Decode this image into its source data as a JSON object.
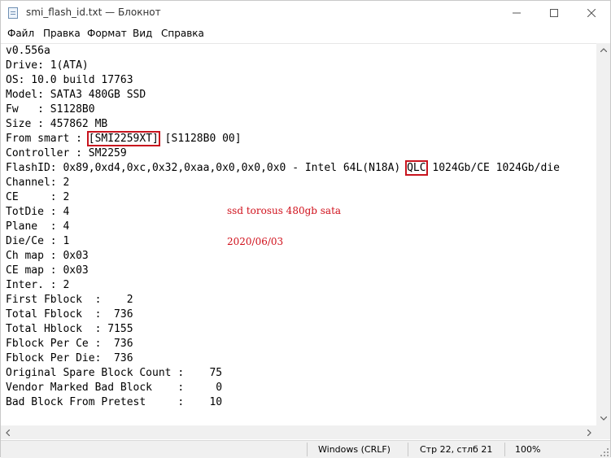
{
  "window": {
    "title": "smi_flash_id.txt — Блокнот",
    "icon": "notepad-icon",
    "controls": [
      "minimize-icon",
      "maximize-icon",
      "close-icon"
    ]
  },
  "menu": {
    "items": [
      "Файл",
      "Правка",
      "Формат",
      "Вид",
      "Справка"
    ]
  },
  "document": {
    "lines": [
      "v0.556a",
      "Drive: 1(ATA)",
      "OS: 10.0 build 17763",
      "Model: SATA3 480GB SSD",
      "Fw   : S1128B0",
      "Size : 457862 MB",
      "From smart : ",
      "Controller : SM2259",
      "FlashID: 0x89,0xd4,0xc,0x32,0xaa,0x0,0x0,0x0 - Intel 64L(N18A) ",
      "Channel: 2",
      "CE     : 2",
      "TotDie : 4",
      "Plane  : 4",
      "Die/Ce : 1",
      "Ch map : 0x03",
      "CE map : 0x03",
      "Inter. : 2",
      "First Fblock  :    2",
      "Total Fblock  :  736",
      "Total Hblock  : 7155",
      "Fblock Per Ce :  736",
      "Fblock Per Die:  736",
      "Original Spare Block Count :    75",
      "Vendor Marked Bad Block    :     0",
      "Bad Block From Pretest     :    10"
    ],
    "smart_highlight": "[SMI2259XT]",
    "smart_rest": " [S1128B0 00]",
    "flash_highlight": "QLC",
    "flash_rest": " 1024Gb/CE 1024Gb/die"
  },
  "annotations": {
    "note": "ssd torosus 480gb sata",
    "date": "2020/06/03",
    "color": "#d0101b"
  },
  "status": {
    "line_ending": "Windows (CRLF)",
    "position": "Стр 22, стлб 21",
    "zoom": "100%"
  }
}
